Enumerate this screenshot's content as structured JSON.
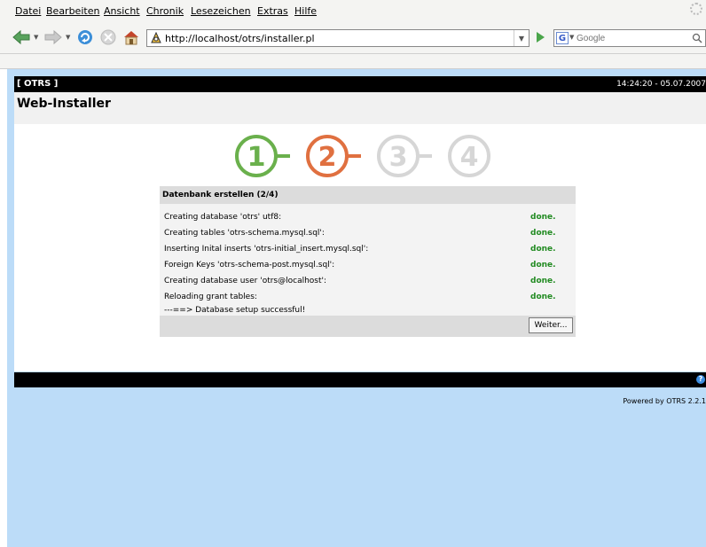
{
  "menu": [
    "Datei",
    "Bearbeiten",
    "Ansicht",
    "Chronik",
    "Lesezeichen",
    "Extras",
    "Hilfe"
  ],
  "nav": {
    "url": "http://localhost/otrs/installer.pl",
    "search_placeholder": "Google"
  },
  "header": {
    "brand": "[ OTRS ]",
    "timestamp": "14:24:20 - 05.07.2007",
    "title": "Web-Installer"
  },
  "steps": [
    {
      "label": "1",
      "color": "#6ab04c",
      "state": "done"
    },
    {
      "label": "2",
      "color": "#e07040",
      "state": "current"
    },
    {
      "label": "3",
      "color": "#d6d6d6",
      "state": "pending"
    },
    {
      "label": "4",
      "color": "#d6d6d6",
      "state": "pending"
    }
  ],
  "box": {
    "title": "Datenbank erstellen (2/4)",
    "rows": [
      {
        "text": "Creating database 'otrs' utf8:",
        "status": "done."
      },
      {
        "text": "Creating tables 'otrs-schema.mysql.sql':",
        "status": "done."
      },
      {
        "text": "Inserting Inital inserts 'otrs-initial_insert.mysql.sql':",
        "status": "done."
      },
      {
        "text": "Foreign Keys 'otrs-schema-post.mysql.sql':",
        "status": "done."
      },
      {
        "text": "Creating database user 'otrs@localhost':",
        "status": "done."
      },
      {
        "text": "Reloading grant tables:",
        "status": "done."
      }
    ],
    "result": "---==> Database setup successful!",
    "button": "Weiter..."
  },
  "footer": {
    "powered": "Powered by OTRS 2.2.1"
  },
  "colors": {
    "done": "#228b22",
    "header": "#000000",
    "page_bg": "#bcdcf8"
  }
}
